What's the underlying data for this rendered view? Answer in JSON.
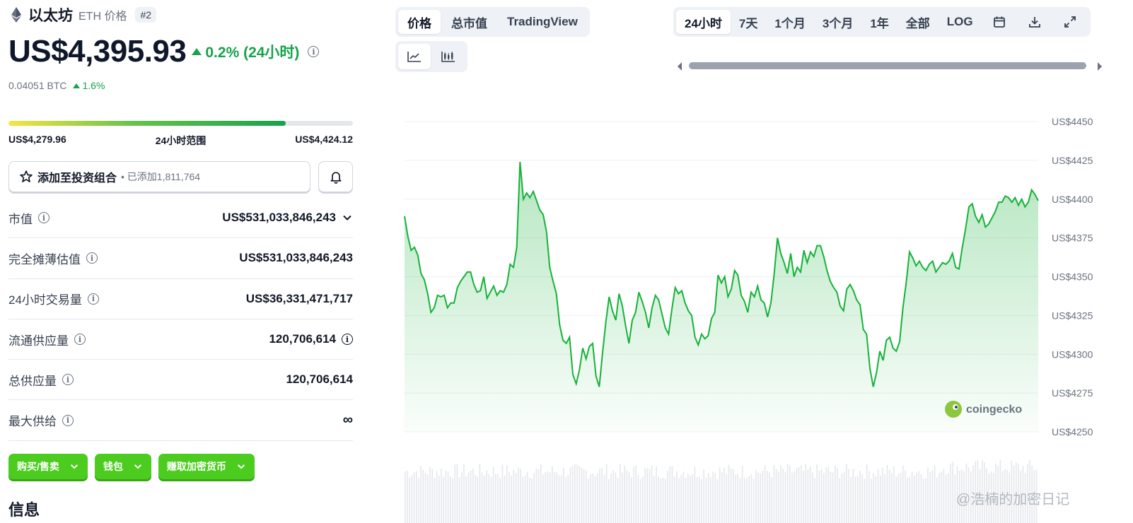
{
  "coin": {
    "name": "以太坊",
    "symbol_label": "ETH 价格",
    "rank": "#2",
    "price": "US$4,395.93",
    "change_24h": "0.2% (24小时)",
    "btc_price": "0.04051 BTC",
    "btc_change": "1.6%"
  },
  "range_24h": {
    "low": "US$4,279.96",
    "label": "24小时范围",
    "high": "US$4,424.12",
    "fill_fraction": 0.805
  },
  "portfolio": {
    "button_label": "添加至投资组合",
    "added_text": "• 已添加1,811,764"
  },
  "stats": [
    {
      "label": "市值",
      "value": "US$531,033,846,243"
    },
    {
      "label": "完全摊薄估值",
      "value": "US$531,033,846,243"
    },
    {
      "label": "24小时交易量",
      "value": "US$36,331,471,717"
    },
    {
      "label": "流通供应量",
      "value": "120,706,614"
    },
    {
      "label": "总供应量",
      "value": "120,706,614"
    },
    {
      "label": "最大供给",
      "value": "∞"
    }
  ],
  "action_buttons": [
    "购买/售卖",
    "钱包",
    "赚取加密货币"
  ],
  "section_heading": "信息",
  "chart_tabs": [
    "价格",
    "总市值",
    "TradingView"
  ],
  "time_ranges": [
    "24小时",
    "7天",
    "1个月",
    "3个月",
    "1年",
    "全部",
    "LOG"
  ],
  "active_tab": "价格",
  "active_range": "24小时",
  "brand": "coingecko",
  "watermark": "@浩楠的加密日记",
  "colors": {
    "up": "#16a34a",
    "line": "#16b23a",
    "button": "#4bcc1f"
  },
  "icons": [
    "ethereum-icon",
    "info-icon",
    "star-icon",
    "bell-icon",
    "line-chart-icon",
    "candlestick-icon",
    "calendar-icon",
    "download-icon",
    "fullscreen-icon",
    "chevron-down-icon"
  ],
  "chart_data": {
    "type": "area",
    "ylim": [
      4250,
      4450
    ],
    "yticks": [
      "US$4450",
      "US$4425",
      "US$4400",
      "US$4375",
      "US$4350",
      "US$4325",
      "US$4300",
      "US$4275",
      "US$4250"
    ],
    "ytick_values": [
      4450,
      4425,
      4400,
      4375,
      4350,
      4325,
      4300,
      4275,
      4250
    ],
    "series": [
      {
        "values": [
          4389,
          4376,
          4367,
          4369,
          4364,
          4352,
          4348,
          4339,
          4327,
          4330,
          4338,
          4337,
          4338,
          4330,
          4333,
          4333,
          4343,
          4347,
          4350,
          4353,
          4353,
          4345,
          4340,
          4341,
          4350,
          4336,
          4340,
          4344,
          4338,
          4341,
          4340,
          4345,
          4358,
          4356,
          4369,
          4424,
          4400,
          4404,
          4401,
          4405,
          4399,
          4393,
          4390,
          4379,
          4356,
          4347,
          4339,
          4319,
          4309,
          4307,
          4311,
          4287,
          4281,
          4290,
          4304,
          4297,
          4305,
          4307,
          4286,
          4279,
          4301,
          4321,
          4337,
          4328,
          4322,
          4339,
          4331,
          4318,
          4307,
          4322,
          4327,
          4340,
          4334,
          4327,
          4317,
          4330,
          4338,
          4335,
          4326,
          4317,
          4313,
          4329,
          4343,
          4339,
          4341,
          4333,
          4328,
          4325,
          4311,
          4306,
          4313,
          4310,
          4312,
          4323,
          4327,
          4351,
          4346,
          4350,
          4337,
          4342,
          4354,
          4351,
          4338,
          4334,
          4327,
          4340,
          4337,
          4344,
          4335,
          4333,
          4324,
          4333,
          4352,
          4375,
          4365,
          4359,
          4352,
          4365,
          4350,
          4356,
          4353,
          4367,
          4359,
          4366,
          4363,
          4370,
          4370,
          4363,
          4354,
          4347,
          4343,
          4340,
          4331,
          4328,
          4342,
          4345,
          4341,
          4335,
          4332,
          4316,
          4313,
          4291,
          4279,
          4288,
          4302,
          4296,
          4309,
          4311,
          4304,
          4302,
          4308,
          4330,
          4346,
          4366,
          4362,
          4357,
          4360,
          4356,
          4354,
          4358,
          4360,
          4353,
          4356,
          4359,
          4358,
          4360,
          4365,
          4356,
          4355,
          4369,
          4381,
          4395,
          4397,
          4389,
          4385,
          4390,
          4382,
          4384,
          4388,
          4392,
          4398,
          4398,
          4402,
          4401,
          4398,
          4401,
          4396,
          4400,
          4395,
          4398,
          4406,
          4403,
          4399
        ]
      }
    ]
  }
}
